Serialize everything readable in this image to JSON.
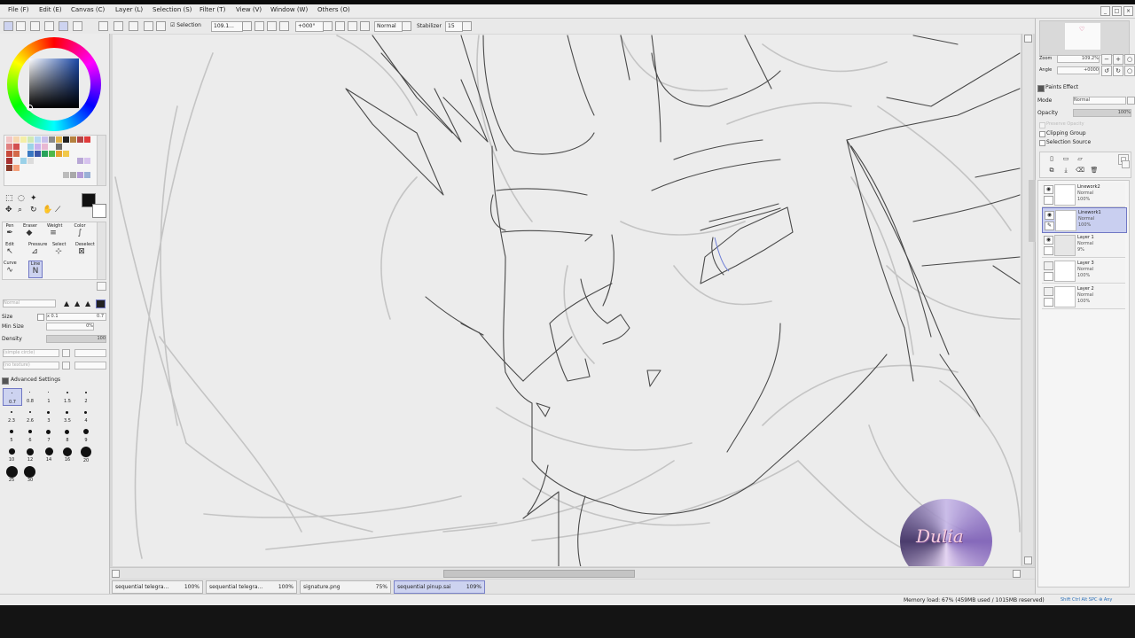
{
  "menubar": {
    "items": [
      "File (F)",
      "Edit (E)",
      "Canvas (C)",
      "Layer (L)",
      "Selection (S)",
      "Filter (T)",
      "View (V)",
      "Window (W)",
      "Others (O)"
    ]
  },
  "toolbar": {
    "selection_label": "Selection",
    "zoom_value": "109.1...",
    "rotation_value": "+000°",
    "blend_mode": "Normal",
    "stabilizer_label": "Stabilizer",
    "stabilizer_value": "15"
  },
  "tools": {
    "labels": [
      "Pen",
      "Eraser",
      "Weight",
      "Color",
      "Edit",
      "Pressure",
      "Select",
      "Deselect",
      "Curve",
      "Line"
    ]
  },
  "brush": {
    "mode_placeholder": "Normal",
    "size_label": "Size",
    "size_multiplier": "x 0.1",
    "size_value": "0.7",
    "min_size_label": "Min Size",
    "min_size_value": "0%",
    "density_label": "Density",
    "density_value": "100",
    "shape_placeholder": "(simple circle)",
    "texture_placeholder": "(no texture)",
    "advanced_label": "Advanced Settings",
    "sizes": [
      "0.7",
      "0.8",
      "1",
      "1.5",
      "2",
      "2.3",
      "2.6",
      "3",
      "3.5",
      "4",
      "5",
      "6",
      "7",
      "8",
      "9",
      "10",
      "12",
      "14",
      "16",
      "20",
      "25",
      "30"
    ]
  },
  "navigator": {
    "zoom_label": "Zoom",
    "zoom_value": "109.2%",
    "angle_label": "Angle",
    "angle_value": "+0000"
  },
  "layer_props": {
    "paint_effect_label": "Paints Effect",
    "mode_label": "Mode",
    "mode_value": "Normal",
    "opacity_label": "Opacity",
    "opacity_value": "100%",
    "preserve_opacity_label": "Preserve Opacity",
    "clipping_group_label": "Clipping Group",
    "selection_source_label": "Selection Source"
  },
  "layers": [
    {
      "name": "Linework2",
      "mode": "Normal",
      "opacity": "100%",
      "selected": false
    },
    {
      "name": "Linework1",
      "mode": "Normal",
      "opacity": "100%",
      "selected": true
    },
    {
      "name": "Layer 1",
      "mode": "Normal",
      "opacity": "9%",
      "selected": false
    },
    {
      "name": "Layer 3",
      "mode": "Normal",
      "opacity": "100%",
      "selected": false
    },
    {
      "name": "Layer 2",
      "mode": "Normal",
      "opacity": "100%",
      "selected": false
    }
  ],
  "tabs": [
    {
      "name": "sequential telegra...",
      "zoom": "100%"
    },
    {
      "name": "sequential telegra...",
      "zoom": "100%"
    },
    {
      "name": "signature.png",
      "zoom": "75%"
    },
    {
      "name": "sequential pinup.sai",
      "zoom": "109%"
    }
  ],
  "status": {
    "memory": "Memory load: 67% (459MB used / 1015MB reserved)",
    "keys": "Shift Ctrl Alt SPC ⊕ Any"
  },
  "watermark": "Dulia",
  "colors": {
    "selection_blue": "#7077c4",
    "selected_bg": "#c9cff0",
    "panel_bg": "#ececec",
    "lineart": "#4a4a4a",
    "sketch": "#bdbdbd"
  }
}
